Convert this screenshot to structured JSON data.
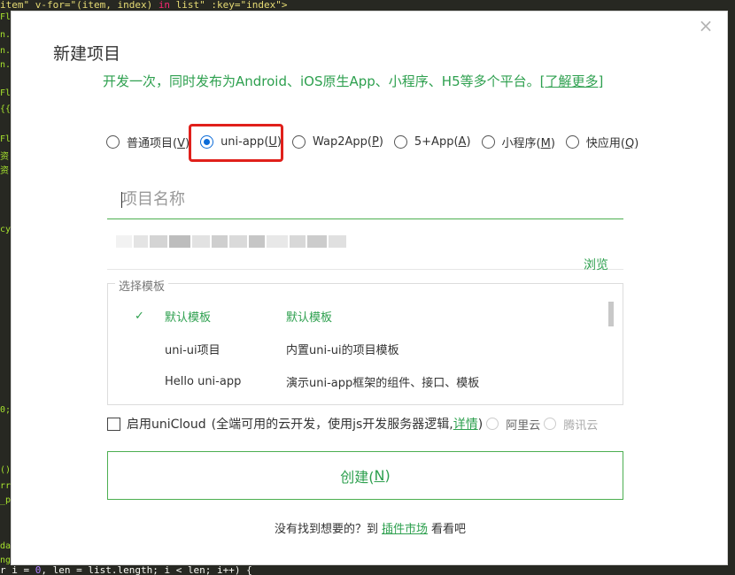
{
  "editor": {
    "top_code_a": "item\" v-for=\"(item, index) ",
    "top_code_kw": "in",
    "top_code_b": " list\" :key=\"index\">",
    "bottom_code_a": "r i = ",
    "bottom_code_num": "0",
    "bottom_code_b": ", len = list.length; i < len; i++) {",
    "gutter": [
      "Fl",
      "n.",
      "n.",
      "n.",
      "Fl",
      "{{",
      "Fl",
      "资",
      "资",
      "cy",
      "0;",
      "()",
      "rr",
      "_p",
      "da",
      "ng"
    ]
  },
  "dialog": {
    "close_icon": "×",
    "title": "新建项目",
    "subtitle": "开发一次，同时发布为Android、iOS原生App、小程序、H5等多个平台。",
    "learn_more": "[了解更多]"
  },
  "project_types": [
    {
      "label": "普通项目(",
      "key": "V",
      "suffix": ")",
      "checked": false
    },
    {
      "label": "uni-app(",
      "key": "U",
      "suffix": ")",
      "checked": true
    },
    {
      "label": "Wap2App(",
      "key": "P",
      "suffix": ")",
      "checked": false
    },
    {
      "label": "5+App(",
      "key": "A",
      "suffix": ")",
      "checked": false
    },
    {
      "label": "小程序(",
      "key": "M",
      "suffix": ")",
      "checked": false
    },
    {
      "label": "快应用(",
      "key": "Q",
      "suffix": ")",
      "checked": false
    }
  ],
  "name_input": {
    "placeholder": "项目名称",
    "value": ""
  },
  "path": {
    "browse": "浏览"
  },
  "templates": {
    "legend": "选择模板",
    "items": [
      {
        "check": "✓",
        "name": "默认模板",
        "desc": "默认模板",
        "selected": true
      },
      {
        "check": "",
        "name": "uni-ui项目",
        "desc": "内置uni-ui的项目模板",
        "selected": false
      },
      {
        "check": "",
        "name": "Hello uni-app",
        "desc": "演示uni-app框架的组件、接口、模板",
        "selected": false
      }
    ]
  },
  "cloud": {
    "label": "启用uniCloud",
    "desc_a": "(全端可用的云开发，使用js开发服务器逻辑,",
    "detail": "详情",
    "desc_b": ")",
    "aliyun": "阿里云",
    "tencent": "腾讯云"
  },
  "create": {
    "label": "创建(",
    "key": "N",
    "suffix": ")"
  },
  "footer": {
    "text_a": "没有找到想要的？到",
    "market": "插件市场",
    "text_b": "看看吧"
  },
  "colors": {
    "accent": "#2ea04f",
    "highlight": "#e0201b",
    "radio": "#0b6bd8"
  }
}
